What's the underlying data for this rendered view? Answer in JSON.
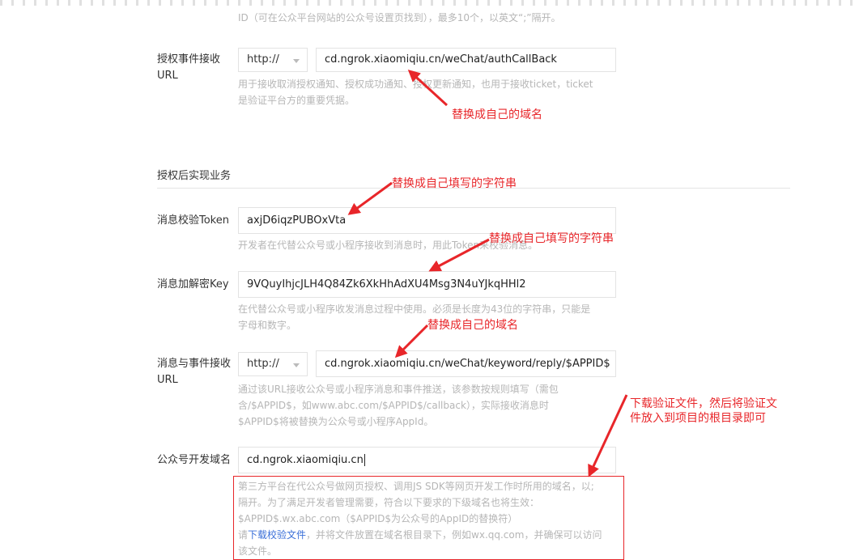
{
  "top_hint": "ID（可在公众平台网站的公众号设置页找到），最多10个，以英文“;”隔开。",
  "auth_event": {
    "label_line1": "授权事件接收",
    "label_line2": "URL",
    "protocol": "http://",
    "value": "cd.ngrok.xiaomiqiu.cn/weChat/authCallBack",
    "hint_line1": "用于接收取消授权通知、授权成功通知、授权更新通知，也用于接收ticket，ticket",
    "hint_line2": "是验证平台方的重要凭据。"
  },
  "section": {
    "title": "授权后实现业务"
  },
  "token": {
    "label": "消息校验Token",
    "value": "axjD6iqzPUBOxVta",
    "hint": "开发者在代替公众号或小程序接收到消息时，用此Token来校验消息。"
  },
  "aes_key": {
    "label": "消息加解密Key",
    "value": "9VQuyIhjcJLH4Q84Zk6XkHhAdXU4Msg3N4uYJkqHHl2",
    "hint_line1": "在代替公众号或小程序收发消息过程中使用。必须是长度为43位的字符串，只能是",
    "hint_line2": "字母和数字。"
  },
  "msg_event": {
    "label_line1": "消息与事件接收",
    "label_line2": "URL",
    "protocol": "http://",
    "value": "cd.ngrok.xiaomiqiu.cn/weChat/keyword/reply/$APPID$",
    "hint_line1": "通过该URL接收公众号或小程序消息和事件推送，该参数按规则填写（需包",
    "hint_line2": "含/$APPID$，如www.abc.com/$APPID$/callback），实际接收消息时",
    "hint_line3": "$APPID$将被替换为公众号或小程序AppId。"
  },
  "dev_domain": {
    "label": "公众号开发域名",
    "value": "cd.ngrok.xiaomiqiu.cn",
    "hint_line1": "第三方平台在代公众号做网页授权、调用JS SDK等网页开发工作时所用的域名，以;",
    "hint_line2": "隔开。为了满足开发者管理需要，符合以下要求的下级域名也将生效：",
    "hint_line3": "$APPID$.wx.abc.com（$APPID$为公众号的AppID的替换符）",
    "hint_line4_pre": "请",
    "hint_line4_link": "下载校验文件",
    "hint_line4_post": "，并将文件放置在域名根目录下，例如wx.qq.com，并确保可以访问",
    "hint_line5": "该文件。"
  },
  "annotations": {
    "a1": "替换成自己的域名",
    "a2": "替换成自己填写的字符串",
    "a3": "替换成自己填写的字符串",
    "a4": "替换成自己的域名",
    "a5_line1": "下载验证文件，然后将验证文",
    "a5_line2": "件放入到项目的根目录即可"
  },
  "colors": {
    "annotation": "#e8262a",
    "hint": "#b6b6b6",
    "link": "#3a6fd8"
  }
}
